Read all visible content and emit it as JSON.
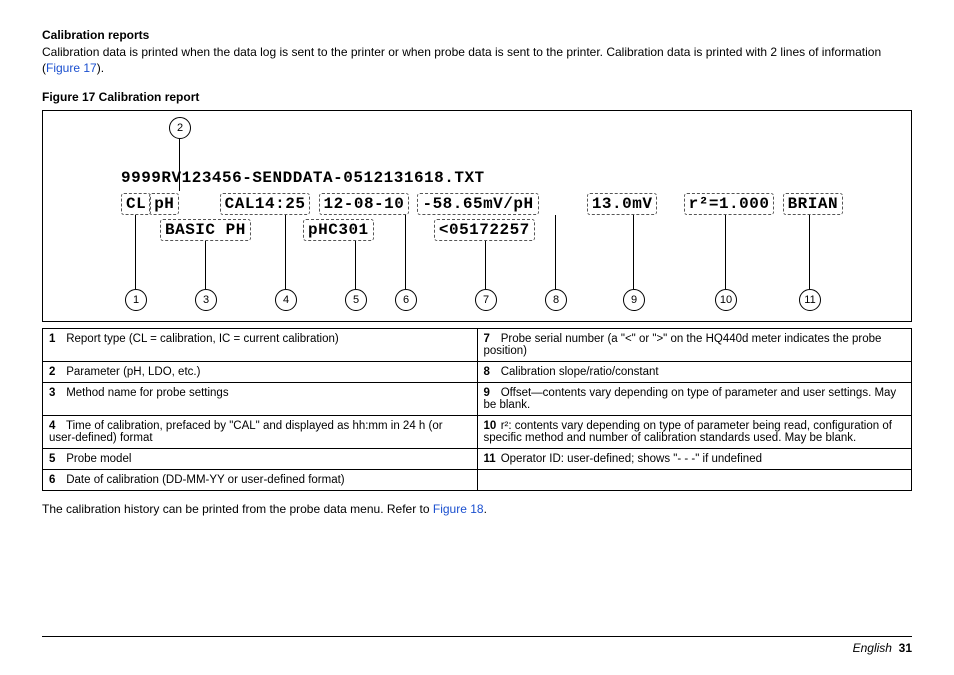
{
  "header": {
    "title": "Calibration reports",
    "para_a": "Calibration data is printed when the data log is sent to the printer or when probe data is sent to the printer. Calibration data is printed with 2 lines of information (",
    "figref1": "Figure 17",
    "para_b": ")."
  },
  "figure": {
    "caption": "Figure 17  Calibration report",
    "filename": "9999RV123456-SENDDATA-0512131618.TXT",
    "seg": {
      "cl": "CL",
      "ph": "pH",
      "cal": "CAL14:25",
      "date": "12-08-10",
      "slope": "-58.65mV/pH",
      "offset": "13.0mV",
      "r2": "r²=1.000",
      "operator": "BRIAN",
      "method": "BASIC PH",
      "model": "pHC301",
      "serial": "<05172257"
    }
  },
  "legend": {
    "l1": "Report type (CL = calibration, IC = current calibration)",
    "l2": "Parameter (pH, LDO, etc.)",
    "l3": "Method name for probe settings",
    "l4": "Time of calibration, prefaced by \"CAL\" and displayed as hh:mm in 24 h (or user-defined) format",
    "l5": "Probe model",
    "l6": "Date of calibration (DD-MM-YY or user-defined format)",
    "l7": "Probe serial number (a \"<\" or \">\" on the HQ440d meter indicates the probe position)",
    "l8": "Calibration slope/ratio/constant",
    "l9": "Offset—contents vary depending on type of parameter and user settings. May be blank.",
    "l10": "r²: contents vary depending on type of parameter being read, configuration of specific method and number of calibration standards used. May be blank.",
    "l11": "Operator ID: user-defined; shows \"- - -\" if undefined"
  },
  "after": {
    "text_a": "The calibration history can be printed from the probe data menu. Refer to ",
    "figref2": "Figure 18",
    "text_b": "."
  },
  "footer": {
    "lang": "English",
    "page": "31"
  },
  "nums": {
    "n1": "1",
    "n2": "2",
    "n3": "3",
    "n4": "4",
    "n5": "5",
    "n6": "6",
    "n7": "7",
    "n8": "8",
    "n9": "9",
    "n10": "10",
    "n11": "11"
  }
}
